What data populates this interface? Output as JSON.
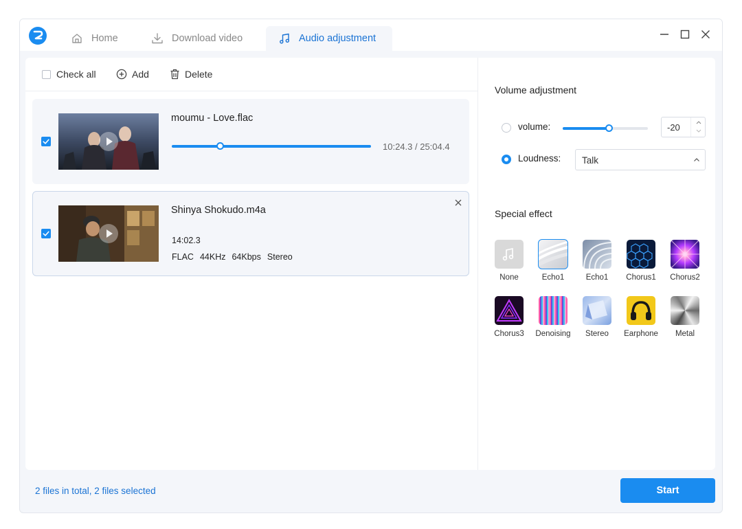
{
  "tabs": {
    "home": "Home",
    "download": "Download video",
    "audio": "Audio adjustment"
  },
  "toolbar": {
    "check_all": "Check all",
    "add": "Add",
    "delete": "Delete"
  },
  "files": [
    {
      "name": "moumu - Love.flac",
      "checked": true,
      "time": "10:24.3 / 25:04.4",
      "progress": 0.24
    },
    {
      "name": "Shinya Shokudo.m4a",
      "checked": true,
      "duration": "14:02.3",
      "format": "FLAC",
      "sample_rate": "44KHz",
      "bitrate": "64Kbps",
      "channels": "Stereo"
    }
  ],
  "status": "2 files in total, 2 files selected",
  "start_label": "Start",
  "volume": {
    "title": "Volume adjustment",
    "volume_label": "volume:",
    "volume_level": 0.54,
    "volume_value": "-20",
    "loudness_label": "Loudness:",
    "loudness_value": "Talk",
    "selected": "loudness"
  },
  "effects": {
    "title": "Special effect",
    "selected": "Echo1-a",
    "items": [
      {
        "label": "None",
        "icon": "music-note-icon"
      },
      {
        "label": "Echo1",
        "icon": "echo-wave-icon"
      },
      {
        "label": "Echo1",
        "icon": "echo-arc-icon"
      },
      {
        "label": "Chorus1",
        "icon": "hexagon-grid-icon"
      },
      {
        "label": "Chorus2",
        "icon": "light-burst-icon"
      },
      {
        "label": "Chorus3",
        "icon": "neon-triangle-icon"
      },
      {
        "label": "Denoising",
        "icon": "spectrum-lines-icon"
      },
      {
        "label": "Stereo",
        "icon": "prism-icon"
      },
      {
        "label": "Earphone",
        "icon": "headphones-icon"
      },
      {
        "label": "Metal",
        "icon": "brushed-metal-icon"
      }
    ]
  },
  "colors": {
    "accent": "#1a8cf0",
    "accent_text": "#1a73d4"
  }
}
